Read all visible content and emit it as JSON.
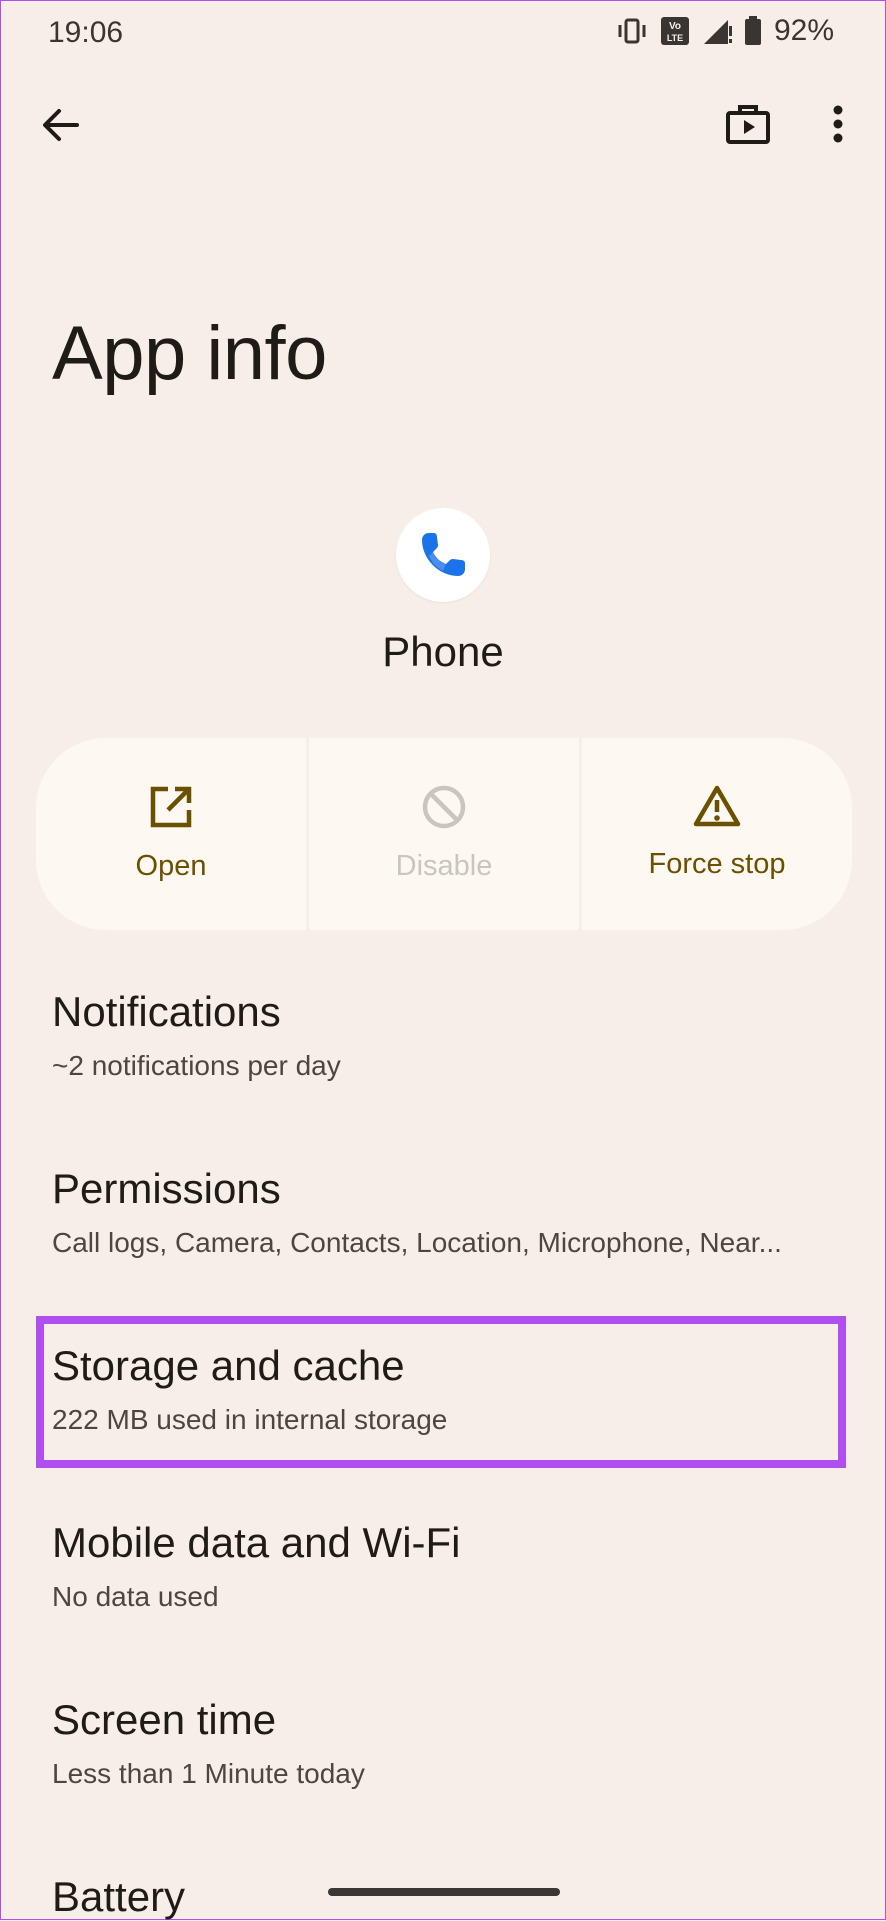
{
  "status_bar": {
    "time": "19:06",
    "battery_percent": "92%",
    "lte_label": "VoLTE"
  },
  "toolbar": {
    "back_icon": "arrow-back-icon",
    "store_icon": "store-icon",
    "more_icon": "more-vert-icon"
  },
  "page": {
    "title": "App info"
  },
  "app": {
    "name": "Phone",
    "icon": "phone-handset-icon"
  },
  "actions": [
    {
      "label": "Open",
      "icon": "open-external-icon",
      "enabled": true
    },
    {
      "label": "Disable",
      "icon": "disable-icon",
      "enabled": false
    },
    {
      "label": "Force stop",
      "icon": "warning-icon",
      "enabled": true
    }
  ],
  "settings": [
    {
      "title": "Notifications",
      "subtitle": "~2 notifications per day"
    },
    {
      "title": "Permissions",
      "subtitle": "Call logs, Camera, Contacts, Location, Microphone, Near..."
    },
    {
      "title": "Storage and cache",
      "subtitle": "222 MB used in internal storage"
    },
    {
      "title": "Mobile data and Wi-Fi",
      "subtitle": "No data used"
    },
    {
      "title": "Screen time",
      "subtitle": "Less than 1 Minute today"
    },
    {
      "title": "Battery",
      "subtitle": ""
    }
  ],
  "colors": {
    "accent": "#6b5000",
    "highlight": "#b14ef0",
    "background": "#f7efe7",
    "panel": "#fdf8f2"
  }
}
